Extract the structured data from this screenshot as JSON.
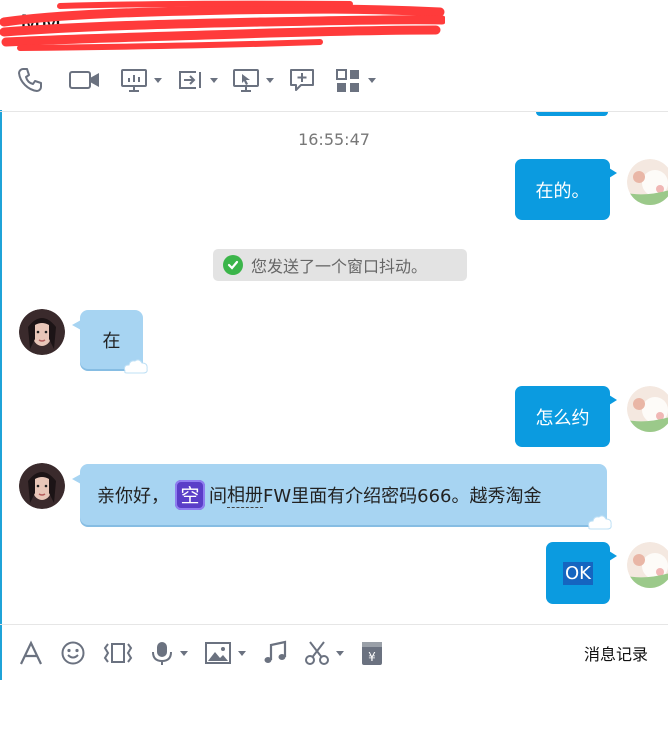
{
  "header": {
    "title": "MM"
  },
  "toolbar_top": {
    "icons": [
      "phone-icon",
      "video-call-icon",
      "screen-share-icon",
      "file-transfer-icon",
      "remote-desktop-icon",
      "add-app-icon",
      "apps-grid-icon"
    ]
  },
  "chat": {
    "timestamp": "16:55:47",
    "messages": [
      {
        "side": "out",
        "text": "在的。"
      },
      {
        "type": "system",
        "text": "您发送了一个窗口抖动。"
      },
      {
        "side": "in",
        "text": "在"
      },
      {
        "side": "out",
        "text": "怎么约"
      },
      {
        "side": "in",
        "prefix": "亲你好，",
        "space_icon_text": "空",
        "mid": "间",
        "album_link": "相册",
        "suffix": "FW里面有介绍密码666。越秀淘金"
      },
      {
        "side": "out",
        "text": "OK"
      }
    ]
  },
  "toolbar_bottom": {
    "history_label": "消息记录"
  },
  "colors": {
    "outgoing_bubble": "#0b9be0",
    "incoming_bubble": "#a7d4f2",
    "system_notice": "#e3e3e3",
    "accent_border": "#1fa3d8",
    "redaction": "#ff3b3b"
  }
}
